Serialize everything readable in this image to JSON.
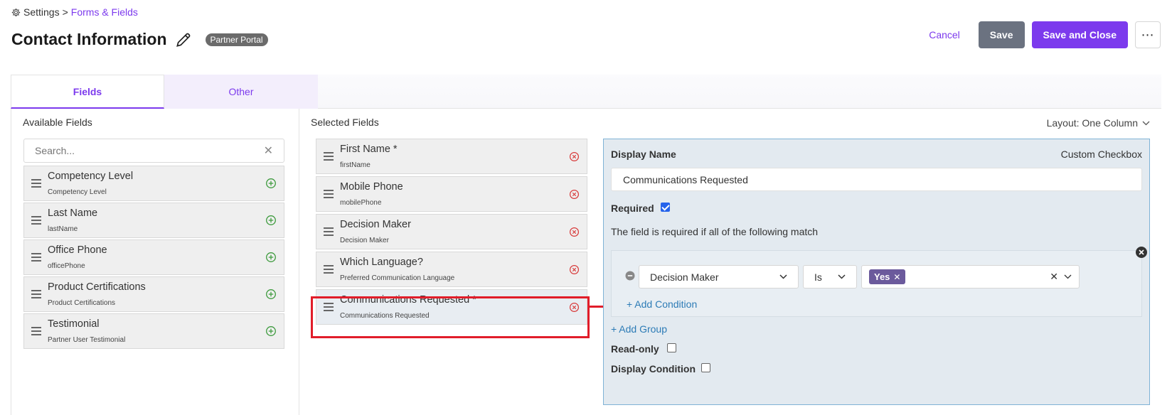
{
  "breadcrumb": {
    "root": "Settings",
    "separator": ">",
    "current": "Forms & Fields",
    "icon": "gear-icon"
  },
  "header": {
    "title": "Contact Information",
    "badge": "Partner Portal"
  },
  "actions": {
    "cancel": "Cancel",
    "save": "Save",
    "save_close": "Save and Close",
    "more": "⋯"
  },
  "tabs": [
    {
      "label": "Fields",
      "active": true
    },
    {
      "label": "Other",
      "active": false
    }
  ],
  "available": {
    "heading": "Available Fields",
    "search_placeholder": "Search...",
    "items": [
      {
        "name": "Competency Level",
        "sub": "Competency Level"
      },
      {
        "name": "Last Name",
        "sub": "lastName"
      },
      {
        "name": "Office Phone",
        "sub": "officePhone"
      },
      {
        "name": "Product Certifications",
        "sub": "Product Certifications"
      },
      {
        "name": "Testimonial",
        "sub": "Partner User Testimonial"
      }
    ]
  },
  "selected": {
    "heading": "Selected Fields",
    "layout": "Layout: One Column",
    "items": [
      {
        "name": "First Name *",
        "sub": "firstName"
      },
      {
        "name": "Mobile Phone",
        "sub": "mobilePhone"
      },
      {
        "name": "Decision Maker",
        "sub": "Decision Maker"
      },
      {
        "name": "Which Language?",
        "sub": "Preferred Communication Language"
      },
      {
        "name": "Communications Requested *",
        "sub": "Communications Requested"
      }
    ]
  },
  "detail": {
    "display_name_label": "Display Name",
    "type": "Custom Checkbox",
    "display_name_value": "Communications Requested",
    "required_label": "Required",
    "required_checked": true,
    "required_text": "The field is required if all of the following match",
    "condition": {
      "field": "Decision Maker",
      "operator": "Is",
      "value_tag": "Yes"
    },
    "add_condition": "+ Add Condition",
    "add_group": "+ Add Group",
    "readonly_label": "Read-only",
    "readonly_checked": false,
    "display_condition_label": "Display Condition",
    "display_condition_checked": false
  },
  "colors": {
    "accent": "#7c3aed",
    "highlight": "#e11d2a",
    "link": "#2c7bb6",
    "add": "#3d9a3d",
    "remove": "#d83a3a"
  }
}
